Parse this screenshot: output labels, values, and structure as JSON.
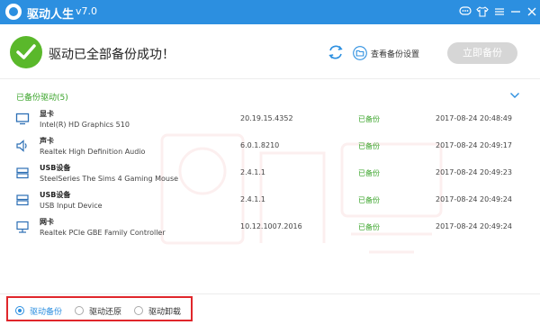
{
  "app": {
    "title": "驱动人生",
    "version": "v7.0"
  },
  "header": {
    "success_message": "驱动已全部备份成功！",
    "view_settings_label": "查看备份设置",
    "backup_now_label": "立即备份"
  },
  "section": {
    "title": "已备份驱动(5)"
  },
  "drivers": [
    {
      "category": "显卡",
      "device": "Intel(R) HD Graphics 510",
      "version": "20.19.15.4352",
      "status": "已备份",
      "time": "2017-08-24 20:48:49",
      "icon": "monitor-icon"
    },
    {
      "category": "声卡",
      "device": "Realtek High Definition Audio",
      "version": "6.0.1.8210",
      "status": "已备份",
      "time": "2017-08-24 20:49:17",
      "icon": "speaker-icon"
    },
    {
      "category": "USB设备",
      "device": "SteelSeries The Sims 4 Gaming Mouse",
      "version": "2.4.1.1",
      "status": "已备份",
      "time": "2017-08-24 20:49:23",
      "icon": "usb-device-icon"
    },
    {
      "category": "USB设备",
      "device": "USB Input Device",
      "version": "2.4.1.1",
      "status": "已备份",
      "time": "2017-08-24 20:49:24",
      "icon": "usb-device-icon"
    },
    {
      "category": "网卡",
      "device": "Realtek PCIe GBE Family Controller",
      "version": "10.12.1007.2016",
      "status": "已备份",
      "time": "2017-08-24 20:49:24",
      "icon": "network-card-icon"
    }
  ],
  "bottom_tabs": [
    {
      "label": "驱动备份",
      "selected": true
    },
    {
      "label": "驱动还原",
      "selected": false
    },
    {
      "label": "驱动卸载",
      "selected": false
    }
  ],
  "colors": {
    "accent": "#2c8fe0",
    "success": "#3aa42a",
    "highlight_border": "#e0262b"
  }
}
